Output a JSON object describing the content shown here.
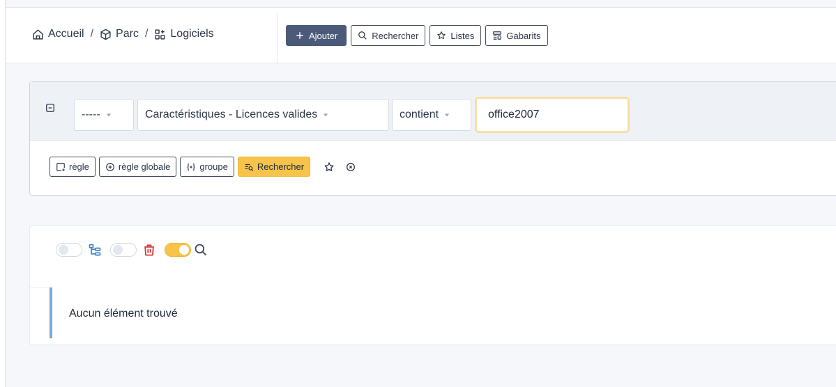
{
  "breadcrumb": {
    "home": "Accueil",
    "assets": "Parc",
    "software": "Logiciels",
    "separator": "/"
  },
  "toolbar": {
    "add_label": "Ajouter",
    "search_label": "Rechercher",
    "lists_label": "Listes",
    "templates_label": "Gabarits"
  },
  "search": {
    "link_select": "-----",
    "field_select": "Caractéristiques - Licences valides",
    "operator_select": "contient",
    "value": "office2007",
    "rule_label": "règle",
    "global_rule_label": "règle globale",
    "group_label": "groupe",
    "submit_label": "Rechercher"
  },
  "results": {
    "empty_message": "Aucun élément trouvé",
    "toggles": [
      {
        "name": "tree-view",
        "on": false
      },
      {
        "name": "trash-view",
        "on": false
      },
      {
        "name": "search-panel",
        "on": true
      }
    ]
  },
  "colors": {
    "primary": "#4a5a78",
    "warning": "#f7c34a",
    "danger": "#d63939",
    "info": "#3b82c4",
    "accent_border": "#7fa6d6"
  }
}
